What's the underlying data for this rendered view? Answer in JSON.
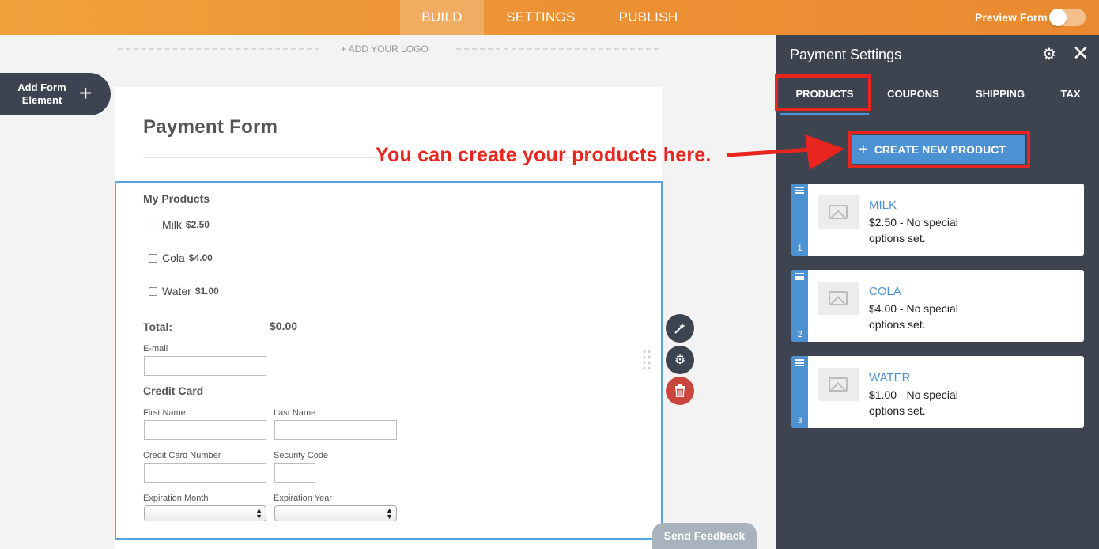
{
  "topbar": {
    "tabs": [
      "BUILD",
      "SETTINGS",
      "PUBLISH"
    ],
    "active_tab": "BUILD",
    "preview_label": "Preview Form",
    "preview_enabled": false,
    "color": "#ec8f33"
  },
  "canvas": {
    "logo_placeholder": "+ ADD YOUR LOGO",
    "add_element": {
      "line1": "Add Form",
      "line2": "Element",
      "icon": "plus-icon"
    },
    "send_feedback": "Send Feedback"
  },
  "form": {
    "title": "Payment Form",
    "products_label": "My Products",
    "products": [
      {
        "name": "Milk",
        "price": "$2.50",
        "checked": false
      },
      {
        "name": "Cola",
        "price": "$4.00",
        "checked": false
      },
      {
        "name": "Water",
        "price": "$1.00",
        "checked": false
      }
    ],
    "total_label": "Total:",
    "total_value": "$0.00",
    "email_label": "E-mail",
    "credit_card_label": "Credit Card",
    "first_name_label": "First Name",
    "last_name_label": "Last Name",
    "card_number_label": "Credit Card Number",
    "security_code_label": "Security Code",
    "exp_month_label": "Expiration Month",
    "exp_year_label": "Expiration Year"
  },
  "element_tools": [
    "magic-wand-icon",
    "gear-icon",
    "trash-icon"
  ],
  "panel": {
    "title": "Payment Settings",
    "tabs": [
      "PRODUCTS",
      "COUPONS",
      "SHIPPING",
      "TAX"
    ],
    "active_tab": "PRODUCTS",
    "create_button": "CREATE NEW PRODUCT",
    "products": [
      {
        "index": "1",
        "name": "MILK",
        "desc": "$2.50 - No special options set."
      },
      {
        "index": "2",
        "name": "COLA",
        "desc": "$4.00 - No special options set."
      },
      {
        "index": "3",
        "name": "WATER",
        "desc": "$1.00 - No special options set."
      }
    ],
    "accent": "#4c91d1",
    "background": "#3d4450"
  },
  "annotation": {
    "text": "You can create your products here.",
    "color": "#e8261f"
  }
}
